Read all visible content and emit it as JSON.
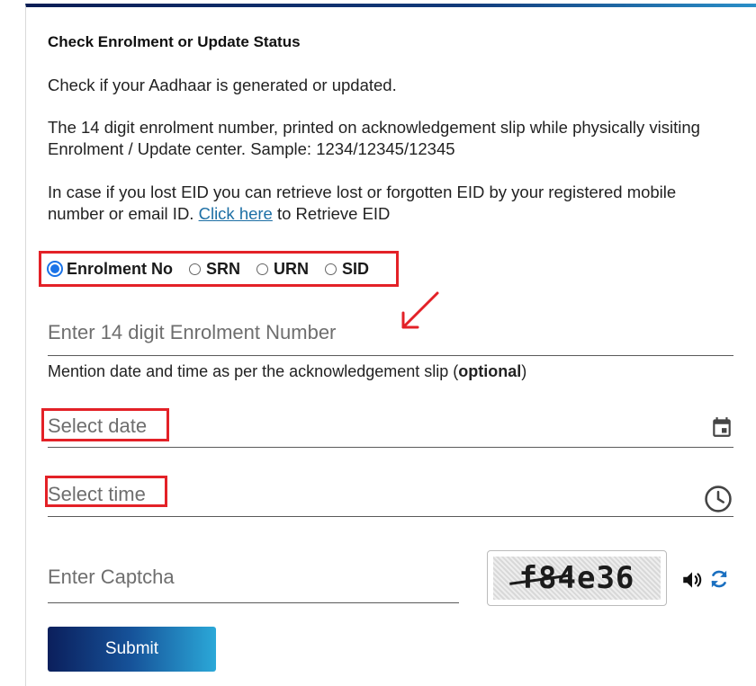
{
  "header": {
    "title": "Check Enrolment or Update Status"
  },
  "intro": {
    "line1": "Check if your Aadhaar is generated or updated.",
    "line2": "The 14 digit enrolment number, printed on acknowledgement slip while physically visiting Enrolment / Update center. Sample: 1234/12345/12345",
    "line3_prefix": "In case if you lost EID you can retrieve lost or forgotten EID by your registered mobile number or email ID. ",
    "line3_link": "Click here",
    "line3_suffix": " to Retrieve EID"
  },
  "id_type": {
    "selected": "Enrolment No",
    "options": [
      "Enrolment No",
      "SRN",
      "URN",
      "SID"
    ]
  },
  "enrolment_input": {
    "placeholder": "Enter 14 digit Enrolment Number",
    "value": ""
  },
  "date_time_hint": {
    "prefix": "Mention date and time as per the acknowledgement slip (",
    "bold": "optional",
    "suffix": ")"
  },
  "date_input": {
    "placeholder": "Select date",
    "icon": "calendar-icon"
  },
  "time_input": {
    "placeholder": "Select time",
    "icon": "clock-icon"
  },
  "captcha": {
    "placeholder": "Enter Captcha",
    "image_text": "f84e36",
    "audio_icon": "speaker-icon",
    "refresh_icon": "refresh-icon"
  },
  "submit_label": "Submit",
  "colors": {
    "accent_blue": "#1a73e8",
    "link": "#1d6fa5",
    "annotation_red": "#e32127",
    "button_start": "#0b1f5c",
    "button_end": "#2ba8d8"
  }
}
